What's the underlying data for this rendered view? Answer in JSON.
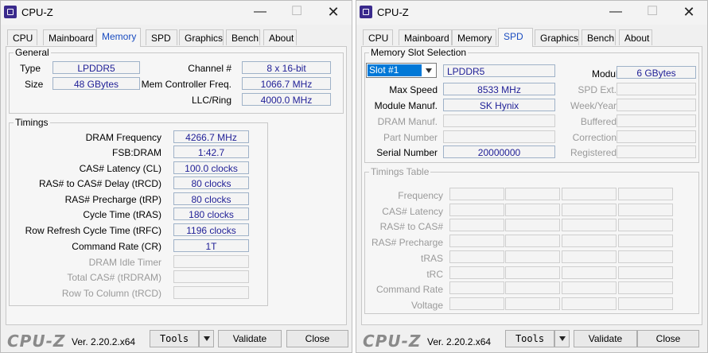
{
  "app_title": "CPU-Z",
  "window_controls": {
    "minimize": "—",
    "maximize": "☐",
    "close": "✕"
  },
  "tabs": [
    "CPU",
    "Mainboard",
    "Memory",
    "SPD",
    "Graphics",
    "Bench",
    "About"
  ],
  "memory": {
    "general_title": "General",
    "type_label": "Type",
    "type_value": "LPDDR5",
    "size_label": "Size",
    "size_value": "48 GBytes",
    "channel_label": "Channel #",
    "channel_value": "8 x 16-bit",
    "mc_freq_label": "Mem Controller Freq.",
    "mc_freq_value": "1066.7 MHz",
    "llc_label": "LLC/Ring",
    "llc_value": "4000.0 MHz",
    "timings_title": "Timings",
    "timings": [
      {
        "label": "DRAM Frequency",
        "value": "4266.7 MHz",
        "enabled": true
      },
      {
        "label": "FSB:DRAM",
        "value": "1:42.7",
        "enabled": true
      },
      {
        "label": "CAS# Latency (CL)",
        "value": "100.0 clocks",
        "enabled": true
      },
      {
        "label": "RAS# to CAS# Delay (tRCD)",
        "value": "80 clocks",
        "enabled": true
      },
      {
        "label": "RAS# Precharge (tRP)",
        "value": "80 clocks",
        "enabled": true
      },
      {
        "label": "Cycle Time (tRAS)",
        "value": "180 clocks",
        "enabled": true
      },
      {
        "label": "Row Refresh Cycle Time (tRFC)",
        "value": "1196 clocks",
        "enabled": true
      },
      {
        "label": "Command Rate (CR)",
        "value": "1T",
        "enabled": true
      },
      {
        "label": "DRAM Idle Timer",
        "value": "",
        "enabled": false
      },
      {
        "label": "Total CAS# (tRDRAM)",
        "value": "",
        "enabled": false
      },
      {
        "label": "Row To Column (tRCD)",
        "value": "",
        "enabled": false
      }
    ]
  },
  "spd": {
    "slot_section_title": "Memory Slot Selection",
    "slot_selected": "Slot #1",
    "module_type": "LPDDR5",
    "module_size_label": "Module Size",
    "module_size_value": "6 GBytes",
    "max_speed_label": "Max Speed",
    "max_speed_value": "8533 MHz",
    "spd_ext_label": "SPD Ext.",
    "module_manuf_label": "Module Manuf.",
    "module_manuf_value": "SK Hynix",
    "week_year_label": "Week/Year",
    "dram_manuf_label": "DRAM Manuf.",
    "buffered_label": "Buffered",
    "part_number_label": "Part Number",
    "correction_label": "Correction",
    "serial_number_label": "Serial Number",
    "serial_number_value": "20000000",
    "registered_label": "Registered",
    "timings_table_title": "Timings Table",
    "timings_table_rows": [
      "Frequency",
      "CAS# Latency",
      "RAS# to CAS#",
      "RAS# Precharge",
      "tRAS",
      "tRC",
      "Command Rate",
      "Voltage"
    ]
  },
  "footer": {
    "logo": "CPU-Z",
    "version": "Ver. 2.20.2.x64",
    "tools_label": "Tools",
    "validate_label": "Validate",
    "close_label": "Close"
  }
}
